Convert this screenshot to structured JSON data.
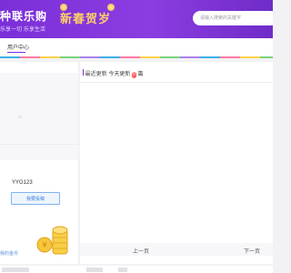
{
  "header": {
    "logo_text": "种联乐购",
    "logo_subtitle": "乐享一切 乐享生活",
    "promo_text": "新春贺岁",
    "search_placeholder": "请输入搜索的关键字"
  },
  "nav": {
    "user_center": "用户中心"
  },
  "profile": {
    "spinner": "⁘",
    "username": "YYG123",
    "submit_button": "我要投稿",
    "coin_label": "我的金币"
  },
  "updates": {
    "title": "最近更新",
    "today_prefix": "今天更新",
    "today_count": "0",
    "today_suffix": "篇"
  },
  "pager": {
    "prev": "上一页",
    "next": "下一页"
  },
  "colors": {
    "banner": "#7b2fd8",
    "accent": "#3d82d8",
    "badge": "#ff5a5a"
  }
}
